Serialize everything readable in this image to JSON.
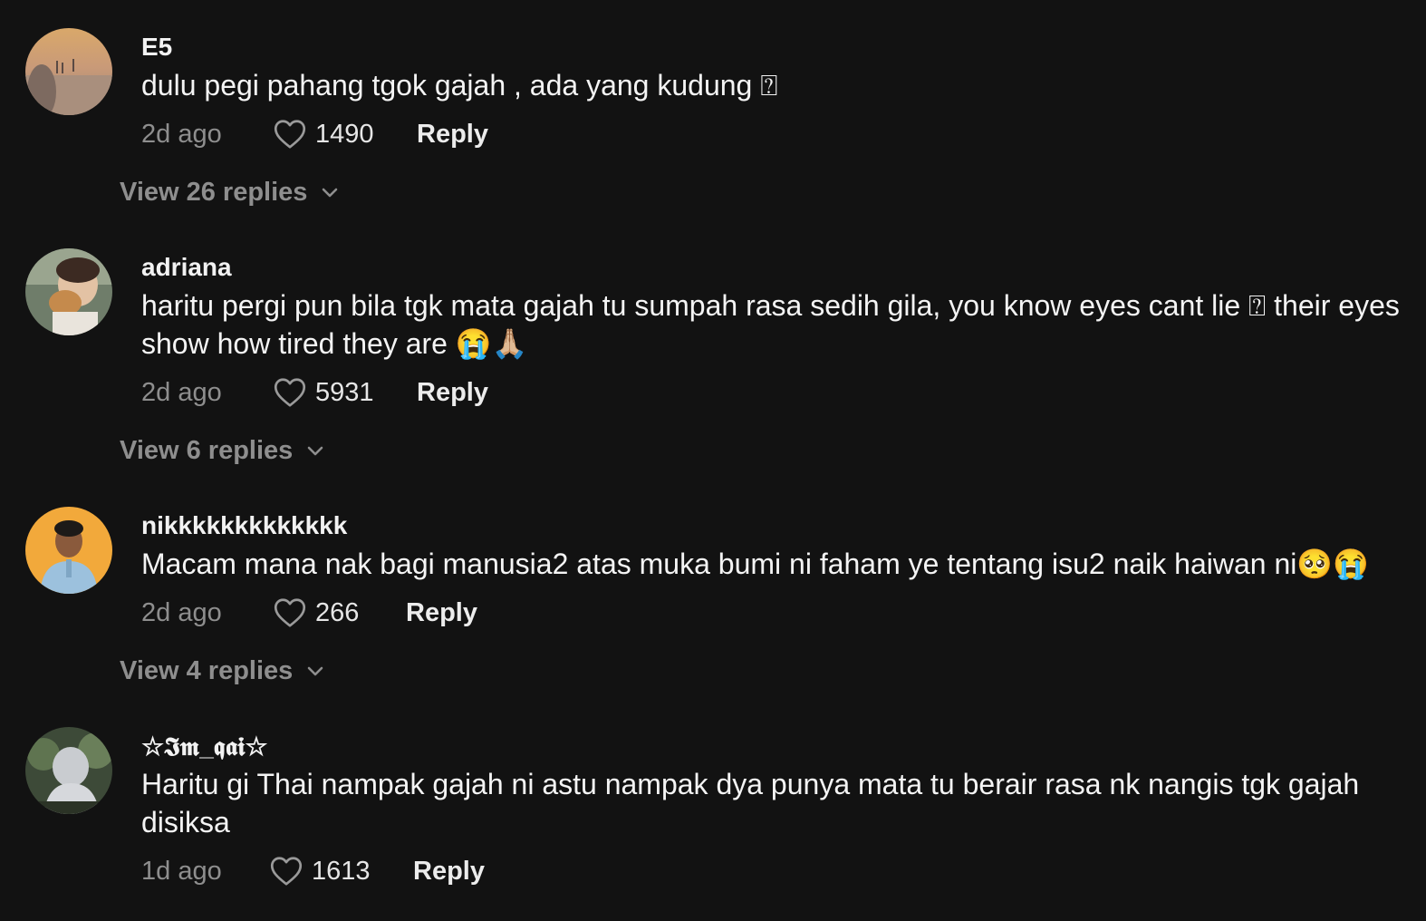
{
  "comments": [
    {
      "username": "E5",
      "text": "dulu pegi pahang tgok gajah , ada yang kudung ⍰",
      "time": "2d ago",
      "likes": "1490",
      "reply_label": "Reply",
      "view_replies": "View 26 replies"
    },
    {
      "username": "adriana",
      "text": "haritu pergi pun bila tgk mata gajah tu sumpah rasa sedih gila, you know eyes cant lie ⍰ their eyes show how tired they are 😭🙏🏼",
      "time": "2d ago",
      "likes": "5931",
      "reply_label": "Reply",
      "view_replies": "View 6 replies"
    },
    {
      "username": "nikkkkkkkkkkkkk",
      "text": "Macam mana nak bagi manusia2 atas muka bumi ni faham ye tentang isu2 naik haiwan ni🥺😭",
      "time": "2d ago",
      "likes": "266",
      "reply_label": "Reply",
      "view_replies": "View 4 replies"
    },
    {
      "username": "☆𝕴𝖒_𝖖𝖆𝖎☆",
      "text": "Haritu gi Thai nampak gajah ni astu nampak dya punya mata tu berair rasa nk nangis tgk gajah disiksa",
      "time": "1d ago",
      "likes": "1613",
      "reply_label": "Reply"
    }
  ],
  "colors": {
    "background": "#121212",
    "text": "#f4f4f4",
    "muted": "#8e8e8e"
  },
  "icons": [
    "heart-icon",
    "chevron-down-icon"
  ]
}
